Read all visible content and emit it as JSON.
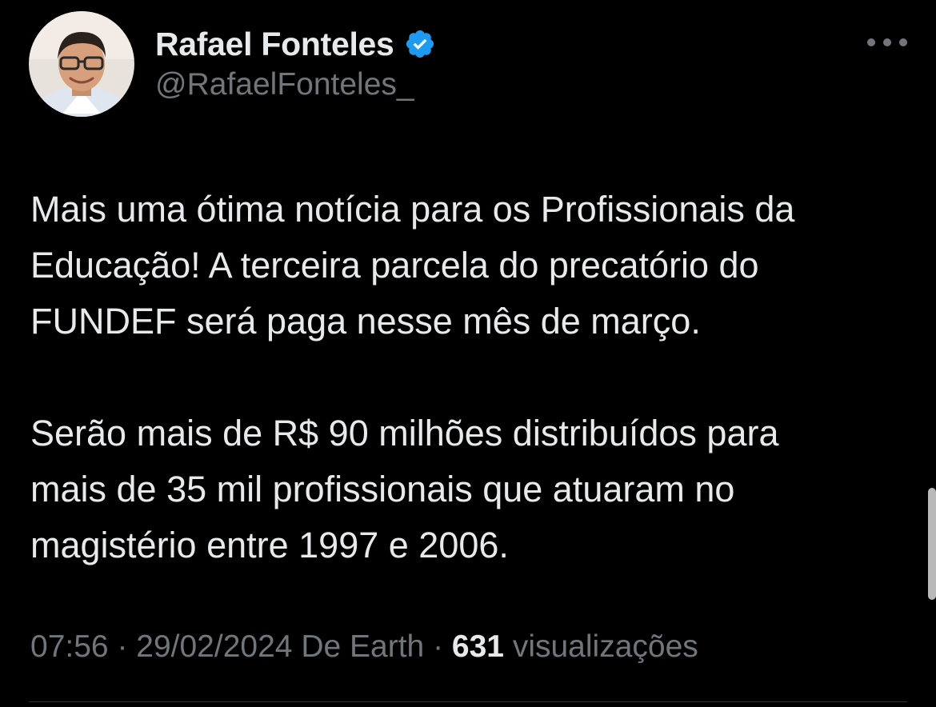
{
  "author": {
    "name": "Rafael Fonteles",
    "handle": "@RafaelFonteles_",
    "verified": true,
    "verified_color": "#1d9bf0",
    "avatar_icon": "profile-photo"
  },
  "more_menu": {
    "icon": "more-horizontal-icon"
  },
  "tweet": {
    "lines": [
      "Mais uma ótima notícia para os Profissionais da",
      "Educação! A terceira parcela do precatório do",
      "FUNDEF será paga nesse mês de março.",
      "Serão mais de R$ 90 milhões distribuídos para",
      "mais de 35 mil profissionais que atuaram no",
      "magistério entre 1997 e 2006."
    ]
  },
  "meta": {
    "time": "07:56",
    "sep1": " · ",
    "date": "29/02/2024",
    "source": "De Earth",
    "sep2": " · ",
    "views_count": "631",
    "views_label": "visualizações"
  },
  "colors": {
    "background": "#000000",
    "text": "#e7e9ea",
    "secondary": "#71767b",
    "accent": "#1d9bf0"
  }
}
